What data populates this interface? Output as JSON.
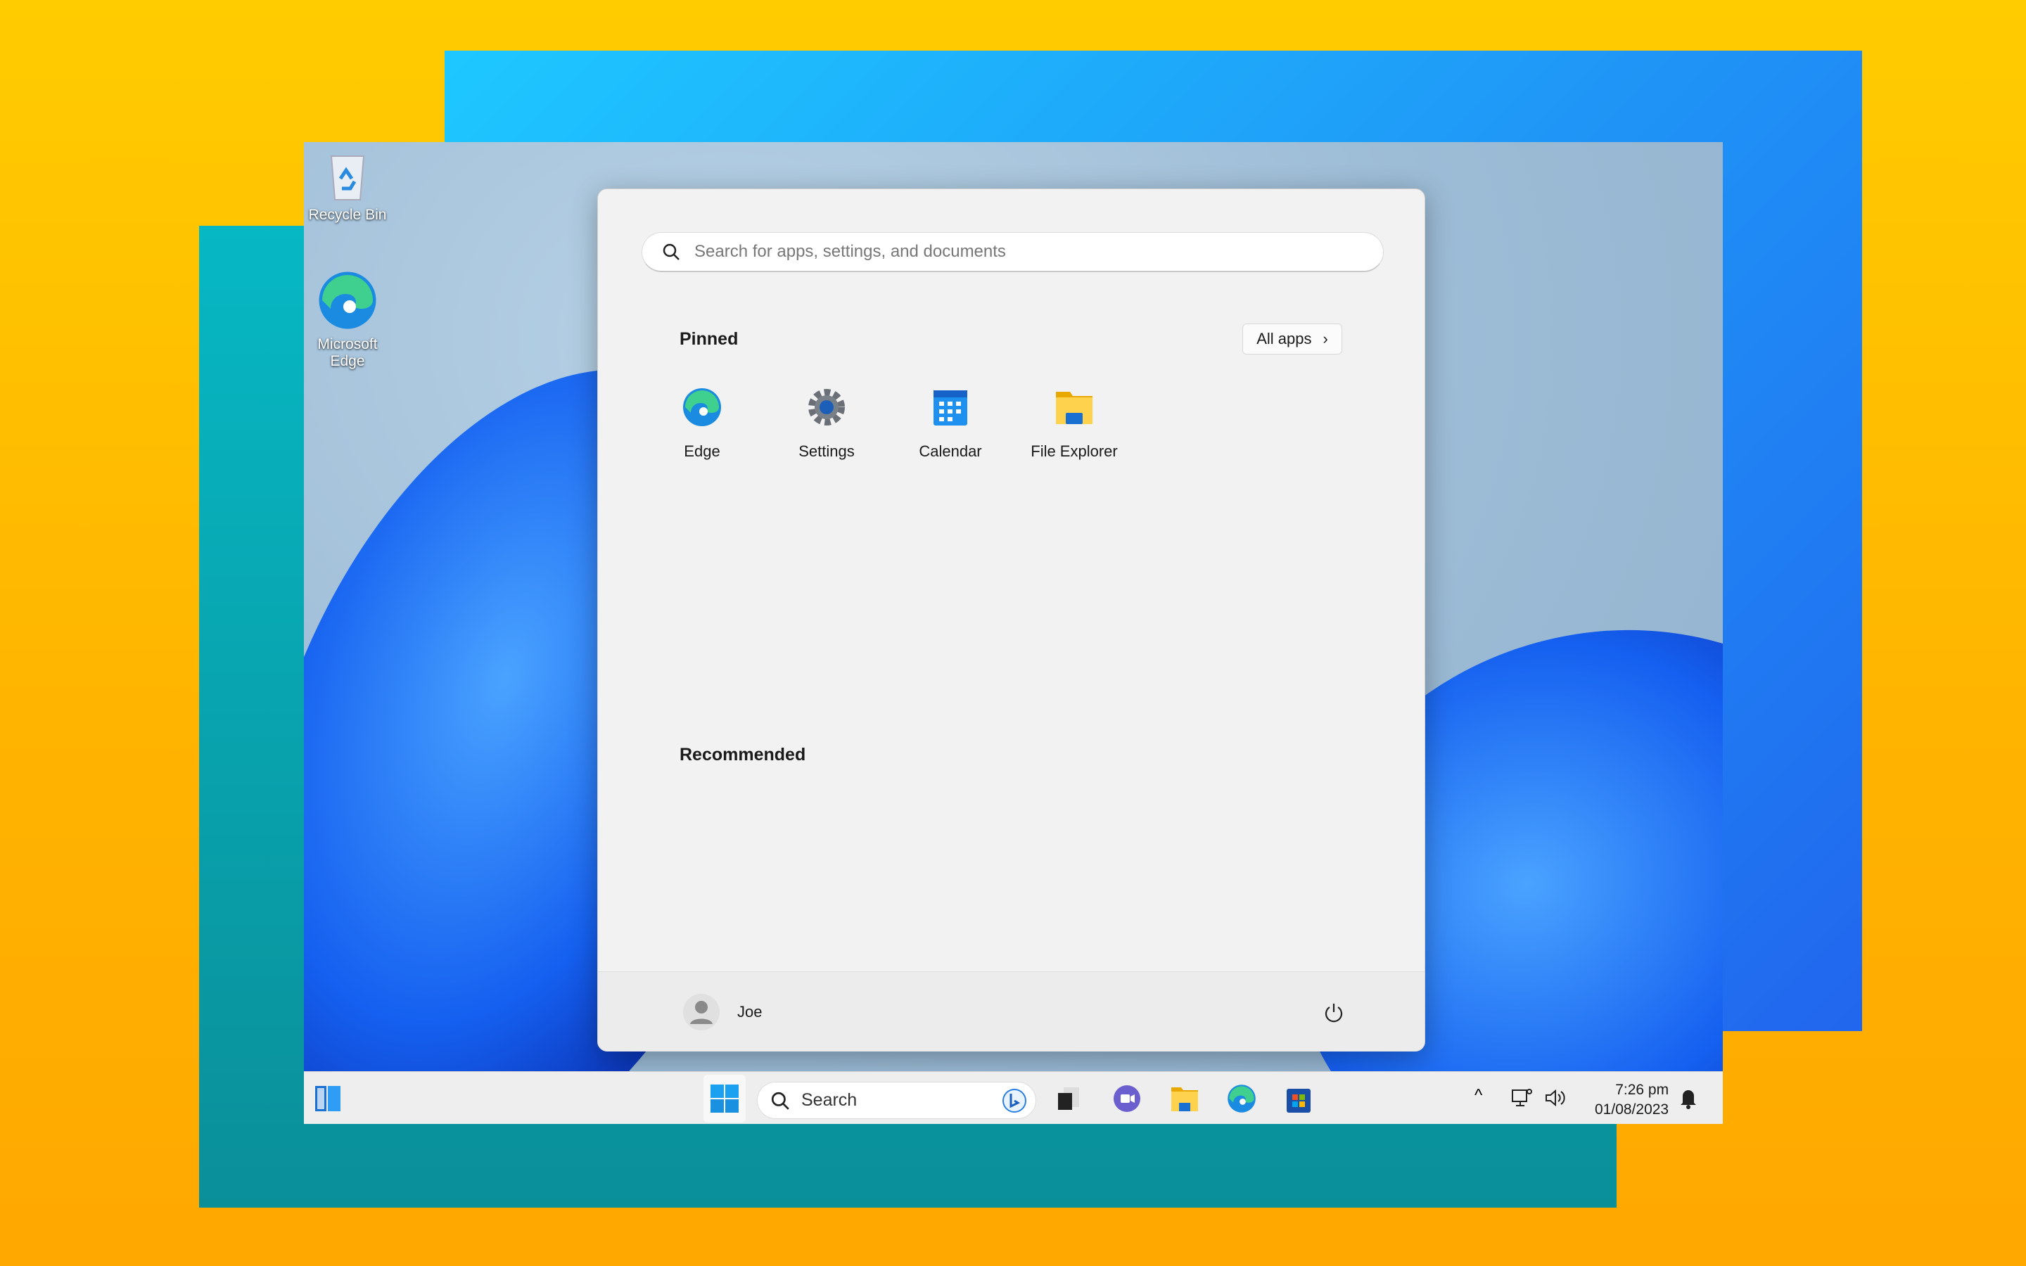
{
  "desktop": {
    "icons": [
      {
        "label": "Recycle Bin",
        "icon": "recycle-bin-icon"
      },
      {
        "label": "Microsoft Edge",
        "icon": "edge-icon"
      }
    ]
  },
  "start_menu": {
    "search_placeholder": "Search for apps, settings, and documents",
    "pinned_title": "Pinned",
    "all_apps_label": "All apps",
    "pinned": [
      {
        "label": "Edge",
        "icon": "edge-icon"
      },
      {
        "label": "Settings",
        "icon": "gear-icon"
      },
      {
        "label": "Calendar",
        "icon": "calendar-icon"
      },
      {
        "label": "File Explorer",
        "icon": "folder-icon"
      }
    ],
    "recommended_title": "Recommended",
    "user_name": "Joe"
  },
  "taskbar": {
    "search_label": "Search",
    "time": "7:26 pm",
    "date": "01/08/2023",
    "apps": [
      "widgets-icon",
      "windows-start-icon",
      "task-view-icon",
      "teams-chat-icon",
      "file-explorer-icon",
      "edge-icon",
      "store-icon"
    ]
  },
  "colors": {
    "accent": "#0067c0",
    "bg_top": "#ffcc00",
    "bg_bottom": "#ffa800"
  }
}
